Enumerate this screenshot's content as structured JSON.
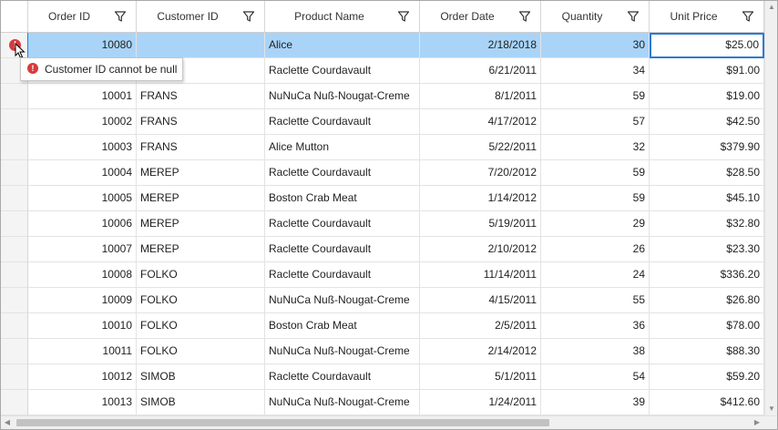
{
  "grid": {
    "columns": [
      {
        "label": "Order ID"
      },
      {
        "label": "Customer ID"
      },
      {
        "label": "Product Name"
      },
      {
        "label": "Order Date"
      },
      {
        "label": "Quantity"
      },
      {
        "label": "Unit Price"
      }
    ],
    "rows": [
      [
        "10080",
        "",
        "Alice",
        "2/18/2018",
        "30",
        "$25.00"
      ],
      [
        "",
        "",
        "Raclette Courdavault",
        "6/21/2011",
        "34",
        "$91.00"
      ],
      [
        "10001",
        "FRANS",
        "NuNuCa Nuß-Nougat-Creme",
        "8/1/2011",
        "59",
        "$19.00"
      ],
      [
        "10002",
        "FRANS",
        "Raclette Courdavault",
        "4/17/2012",
        "57",
        "$42.50"
      ],
      [
        "10003",
        "FRANS",
        "Alice Mutton",
        "5/22/2011",
        "32",
        "$379.90"
      ],
      [
        "10004",
        "MEREP",
        "Raclette Courdavault",
        "7/20/2012",
        "59",
        "$28.50"
      ],
      [
        "10005",
        "MEREP",
        "Boston Crab Meat",
        "1/14/2012",
        "59",
        "$45.10"
      ],
      [
        "10006",
        "MEREP",
        "Raclette Courdavault",
        "5/19/2011",
        "29",
        "$32.80"
      ],
      [
        "10007",
        "MEREP",
        "Raclette Courdavault",
        "2/10/2012",
        "26",
        "$23.30"
      ],
      [
        "10008",
        "FOLKO",
        "Raclette Courdavault",
        "11/14/2011",
        "24",
        "$336.20"
      ],
      [
        "10009",
        "FOLKO",
        "NuNuCa Nuß-Nougat-Creme",
        "4/15/2011",
        "55",
        "$26.80"
      ],
      [
        "10010",
        "FOLKO",
        "Boston Crab Meat",
        "2/5/2011",
        "36",
        "$78.00"
      ],
      [
        "10011",
        "FOLKO",
        "NuNuCa Nuß-Nougat-Creme",
        "2/14/2012",
        "38",
        "$88.30"
      ],
      [
        "10012",
        "SIMOB",
        "Raclette Courdavault",
        "5/1/2011",
        "54",
        "$59.20"
      ],
      [
        "10013",
        "SIMOB",
        "NuNuCa Nuß-Nougat-Creme",
        "1/24/2011",
        "39",
        "$412.60"
      ]
    ]
  },
  "validation": {
    "error_message": "Customer ID cannot be null",
    "error_glyph": "!"
  },
  "icons": {
    "filter": "filter-icon",
    "error": "error-icon",
    "cursor": "mouse-pointer-icon"
  },
  "colors": {
    "selection": "#a9d4f8",
    "current_cell_border": "#2c7bd2",
    "error": "#d83b3b"
  }
}
